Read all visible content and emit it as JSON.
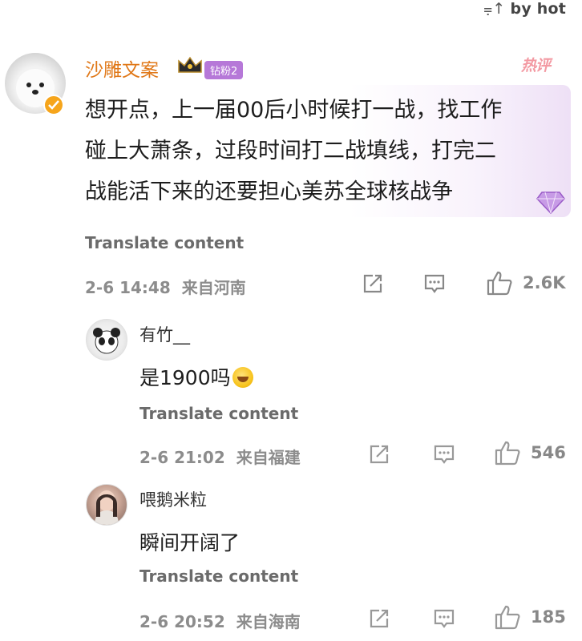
{
  "sort": {
    "label": "by hot",
    "icon": "sort-icon"
  },
  "main_comment": {
    "username": "沙雕文案",
    "fan_badge": "钻粉2",
    "hot_tag": "热评",
    "text_lines": [
      "想开点，上一届00后小时候打一战，找工作",
      "碰上大萧条，过段时间打二战填线，打完二",
      "战能活下来的还要担心美苏全球核战争"
    ],
    "translate": "Translate content",
    "time": "2-6 14:48",
    "location": "来自河南",
    "likes": "2.6K"
  },
  "replies": [
    {
      "username": "有竹__",
      "text": "是1900吗",
      "translate": "Translate content",
      "time": "2-6 21:02",
      "location": "来自福建",
      "likes": "546"
    },
    {
      "username": "喂鹅米粒",
      "text": "瞬间开阔了",
      "translate": "Translate content",
      "time": "2-6 20:52",
      "location": "来自海南",
      "likes": "185"
    }
  ],
  "colors": {
    "username_accent": "#e07818",
    "badge": "#b678d8",
    "hot": "#f39aa3",
    "meta": "#8c8c8c"
  }
}
